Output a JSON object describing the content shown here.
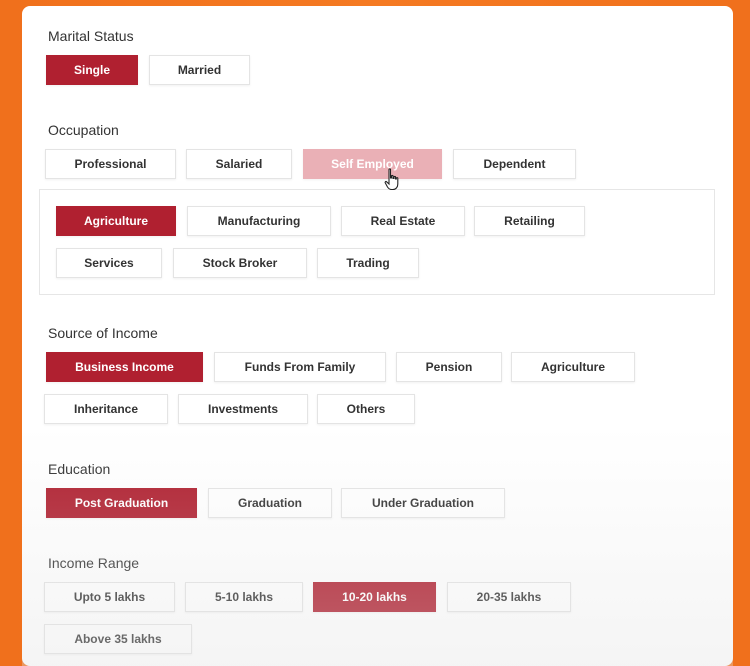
{
  "marital_status": {
    "label": "Marital Status",
    "options": [
      "Single",
      "Married"
    ],
    "selected": "Single"
  },
  "occupation": {
    "label": "Occupation",
    "options": [
      "Professional",
      "Salaried",
      "Self Employed",
      "Dependent"
    ],
    "hovered": "Self Employed",
    "sub_options": [
      "Agriculture",
      "Manufacturing",
      "Real Estate",
      "Retailing",
      "Services",
      "Stock Broker",
      "Trading"
    ],
    "sub_selected": "Agriculture"
  },
  "source_of_income": {
    "label": "Source of Income",
    "options": [
      "Business Income",
      "Funds From Family",
      "Pension",
      "Agriculture",
      "Inheritance",
      "Investments",
      "Others"
    ],
    "selected": "Business Income"
  },
  "education": {
    "label": "Education",
    "options": [
      "Post Graduation",
      "Graduation",
      "Under Graduation"
    ],
    "selected": "Post Graduation"
  },
  "income_range": {
    "label": "Income Range",
    "options": [
      "Upto 5 lakhs",
      "5-10 lakhs",
      "10-20 lakhs",
      "20-35 lakhs",
      "Above 35 lakhs"
    ],
    "selected": "10-20 lakhs"
  },
  "colors": {
    "selected": "#b02030",
    "hover": "#eab0b6",
    "background": "#f57a22"
  },
  "icons": {
    "cursor": "hand-pointer-icon"
  }
}
